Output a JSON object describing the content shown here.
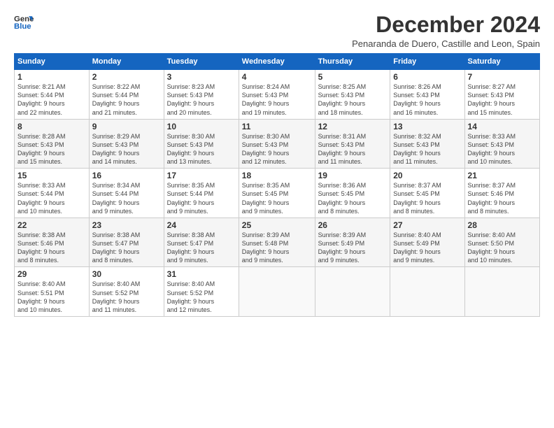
{
  "logo": {
    "line1": "General",
    "line2": "Blue"
  },
  "title": "December 2024",
  "subtitle": "Penaranda de Duero, Castille and Leon, Spain",
  "days_header": [
    "Sunday",
    "Monday",
    "Tuesday",
    "Wednesday",
    "Thursday",
    "Friday",
    "Saturday"
  ],
  "weeks": [
    [
      {
        "day": "1",
        "info": "Sunrise: 8:21 AM\nSunset: 5:44 PM\nDaylight: 9 hours\nand 22 minutes."
      },
      {
        "day": "2",
        "info": "Sunrise: 8:22 AM\nSunset: 5:44 PM\nDaylight: 9 hours\nand 21 minutes."
      },
      {
        "day": "3",
        "info": "Sunrise: 8:23 AM\nSunset: 5:43 PM\nDaylight: 9 hours\nand 20 minutes."
      },
      {
        "day": "4",
        "info": "Sunrise: 8:24 AM\nSunset: 5:43 PM\nDaylight: 9 hours\nand 19 minutes."
      },
      {
        "day": "5",
        "info": "Sunrise: 8:25 AM\nSunset: 5:43 PM\nDaylight: 9 hours\nand 18 minutes."
      },
      {
        "day": "6",
        "info": "Sunrise: 8:26 AM\nSunset: 5:43 PM\nDaylight: 9 hours\nand 16 minutes."
      },
      {
        "day": "7",
        "info": "Sunrise: 8:27 AM\nSunset: 5:43 PM\nDaylight: 9 hours\nand 15 minutes."
      }
    ],
    [
      {
        "day": "8",
        "info": "Sunrise: 8:28 AM\nSunset: 5:43 PM\nDaylight: 9 hours\nand 15 minutes."
      },
      {
        "day": "9",
        "info": "Sunrise: 8:29 AM\nSunset: 5:43 PM\nDaylight: 9 hours\nand 14 minutes."
      },
      {
        "day": "10",
        "info": "Sunrise: 8:30 AM\nSunset: 5:43 PM\nDaylight: 9 hours\nand 13 minutes."
      },
      {
        "day": "11",
        "info": "Sunrise: 8:30 AM\nSunset: 5:43 PM\nDaylight: 9 hours\nand 12 minutes."
      },
      {
        "day": "12",
        "info": "Sunrise: 8:31 AM\nSunset: 5:43 PM\nDaylight: 9 hours\nand 11 minutes."
      },
      {
        "day": "13",
        "info": "Sunrise: 8:32 AM\nSunset: 5:43 PM\nDaylight: 9 hours\nand 11 minutes."
      },
      {
        "day": "14",
        "info": "Sunrise: 8:33 AM\nSunset: 5:43 PM\nDaylight: 9 hours\nand 10 minutes."
      }
    ],
    [
      {
        "day": "15",
        "info": "Sunrise: 8:33 AM\nSunset: 5:44 PM\nDaylight: 9 hours\nand 10 minutes."
      },
      {
        "day": "16",
        "info": "Sunrise: 8:34 AM\nSunset: 5:44 PM\nDaylight: 9 hours\nand 9 minutes."
      },
      {
        "day": "17",
        "info": "Sunrise: 8:35 AM\nSunset: 5:44 PM\nDaylight: 9 hours\nand 9 minutes."
      },
      {
        "day": "18",
        "info": "Sunrise: 8:35 AM\nSunset: 5:45 PM\nDaylight: 9 hours\nand 9 minutes."
      },
      {
        "day": "19",
        "info": "Sunrise: 8:36 AM\nSunset: 5:45 PM\nDaylight: 9 hours\nand 8 minutes."
      },
      {
        "day": "20",
        "info": "Sunrise: 8:37 AM\nSunset: 5:45 PM\nDaylight: 9 hours\nand 8 minutes."
      },
      {
        "day": "21",
        "info": "Sunrise: 8:37 AM\nSunset: 5:46 PM\nDaylight: 9 hours\nand 8 minutes."
      }
    ],
    [
      {
        "day": "22",
        "info": "Sunrise: 8:38 AM\nSunset: 5:46 PM\nDaylight: 9 hours\nand 8 minutes."
      },
      {
        "day": "23",
        "info": "Sunrise: 8:38 AM\nSunset: 5:47 PM\nDaylight: 9 hours\nand 8 minutes."
      },
      {
        "day": "24",
        "info": "Sunrise: 8:38 AM\nSunset: 5:47 PM\nDaylight: 9 hours\nand 9 minutes."
      },
      {
        "day": "25",
        "info": "Sunrise: 8:39 AM\nSunset: 5:48 PM\nDaylight: 9 hours\nand 9 minutes."
      },
      {
        "day": "26",
        "info": "Sunrise: 8:39 AM\nSunset: 5:49 PM\nDaylight: 9 hours\nand 9 minutes."
      },
      {
        "day": "27",
        "info": "Sunrise: 8:40 AM\nSunset: 5:49 PM\nDaylight: 9 hours\nand 9 minutes."
      },
      {
        "day": "28",
        "info": "Sunrise: 8:40 AM\nSunset: 5:50 PM\nDaylight: 9 hours\nand 10 minutes."
      }
    ],
    [
      {
        "day": "29",
        "info": "Sunrise: 8:40 AM\nSunset: 5:51 PM\nDaylight: 9 hours\nand 10 minutes."
      },
      {
        "day": "30",
        "info": "Sunrise: 8:40 AM\nSunset: 5:52 PM\nDaylight: 9 hours\nand 11 minutes."
      },
      {
        "day": "31",
        "info": "Sunrise: 8:40 AM\nSunset: 5:52 PM\nDaylight: 9 hours\nand 12 minutes."
      },
      {
        "day": "",
        "info": ""
      },
      {
        "day": "",
        "info": ""
      },
      {
        "day": "",
        "info": ""
      },
      {
        "day": "",
        "info": ""
      }
    ]
  ]
}
